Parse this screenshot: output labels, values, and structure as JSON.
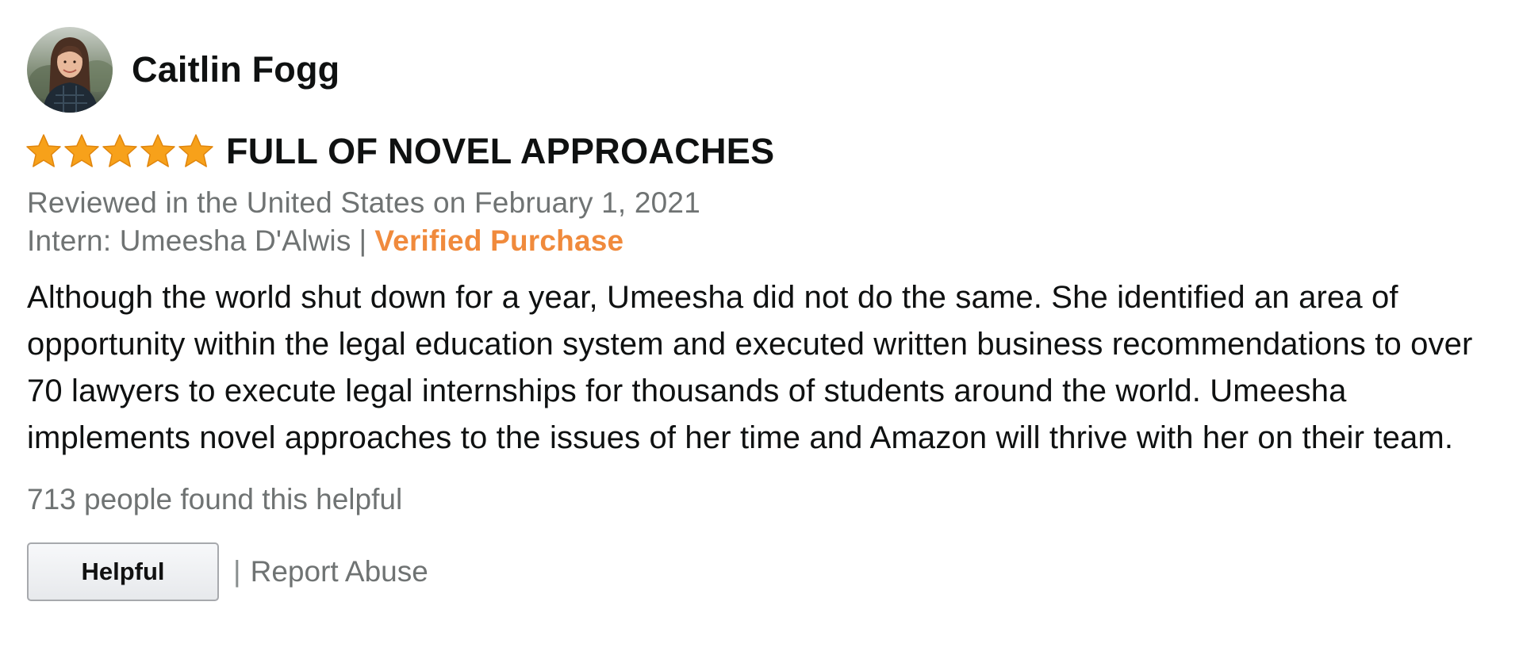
{
  "profile": {
    "name": "Caitlin Fogg",
    "avatar_icon": "person-photo"
  },
  "rating": {
    "stars": 5,
    "max": 5,
    "star_color": "#f7a11a",
    "star_icon": "star-icon"
  },
  "review": {
    "title": "FULL OF NOVEL APPROACHES",
    "date_line": "Reviewed in the United States on February 1, 2021",
    "format_label": "Intern: Umeesha D'Alwis",
    "separator": "|",
    "verified_label": "Verified Purchase",
    "verified_color": "#f08a3c",
    "body": "Although the world shut down for a year, Umeesha did not do the same. She identified an area of opportunity within the legal education system and executed written business recommendations to over 70 lawyers to execute legal internships for thousands of students around the world. Umeesha implements novel approaches to the issues of her time and Amazon will thrive with her on their team.",
    "helpful_count_text": "713 people found this helpful"
  },
  "actions": {
    "helpful_label": "Helpful",
    "separator": "|",
    "report_label": "Report Abuse"
  }
}
